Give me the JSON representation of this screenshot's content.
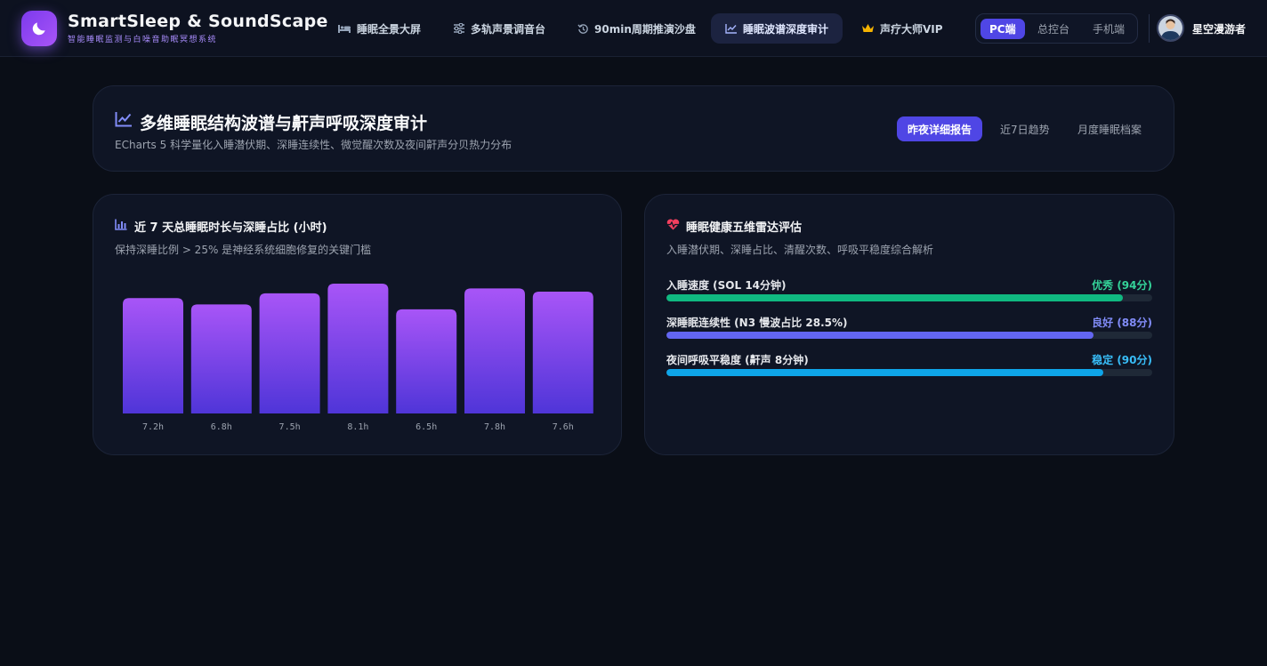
{
  "header": {
    "brand_title": "SmartSleep & SoundScape",
    "brand_subtitle": "智能睡眠监测与白噪音助眠冥想系统",
    "logo_icon": "moon-icon",
    "nav": [
      {
        "label": "睡眠全景大屏",
        "icon": "bed-icon",
        "active": false
      },
      {
        "label": "多轨声景调音台",
        "icon": "sliders-icon",
        "active": false
      },
      {
        "label": "90min周期推演沙盘",
        "icon": "history-icon",
        "active": false
      },
      {
        "label": "睡眠波谱深度审计",
        "icon": "chart-line-icon",
        "active": true
      },
      {
        "label": "声疗大师VIP",
        "icon": "crown-icon",
        "active": false
      }
    ],
    "device_switch": [
      {
        "label": "PC端",
        "active": true
      },
      {
        "label": "总控台",
        "active": false
      },
      {
        "label": "手机端",
        "active": false
      }
    ],
    "username": "星空漫游者"
  },
  "page": {
    "title": "多维睡眠结构波谱与鼾声呼吸深度审计",
    "subtitle": "ECharts 5 科学量化入睡潜伏期、深睡连续性、微觉醒次数及夜间鼾声分贝热力分布",
    "periods": [
      {
        "label": "昨夜详细报告",
        "active": true
      },
      {
        "label": "近7日趋势",
        "active": false
      },
      {
        "label": "月度睡眠档案",
        "active": false
      }
    ]
  },
  "bar_card": {
    "title": "近 7 天总睡眠时长与深睡占比 (小时)",
    "subtitle": "保持深睡比例 > 25% 是神经系统细胞修复的关键门槛"
  },
  "chart_data": {
    "type": "bar",
    "categories": [
      "7.2h",
      "6.8h",
      "7.5h",
      "8.1h",
      "6.5h",
      "7.8h",
      "7.6h"
    ],
    "values": [
      7.2,
      6.8,
      7.5,
      8.1,
      6.5,
      7.8,
      7.6
    ],
    "title": "近 7 天总睡眠时长与深睡占比 (小时)",
    "colors": {
      "top": "#a855f7",
      "bottom": "#4f35d8"
    }
  },
  "radar_card": {
    "title": "睡眠健康五维雷达评估",
    "subtitle": "入睡潜伏期、深睡占比、清醒次数、呼吸平稳度综合解析",
    "metrics": [
      {
        "label": "入睡速度 (SOL 14分钟)",
        "status": "优秀 (94分)",
        "score": 94,
        "color": "#10b981"
      },
      {
        "label": "深睡眠连续性 (N3 慢波占比 28.5%)",
        "status": "良好 (88分)",
        "score": 88,
        "color": "#6366f1"
      },
      {
        "label": "夜间呼吸平稳度 (鼾声 8分钟)",
        "status": "稳定 (90分)",
        "score": 90,
        "color": "#0ea5e9"
      }
    ]
  },
  "colors": {
    "accent": "#4f46e5",
    "background": "#0a0e17",
    "card": "#0f1525",
    "success": "#34d399",
    "good": "#818cf8",
    "stable": "#38bdf8"
  }
}
